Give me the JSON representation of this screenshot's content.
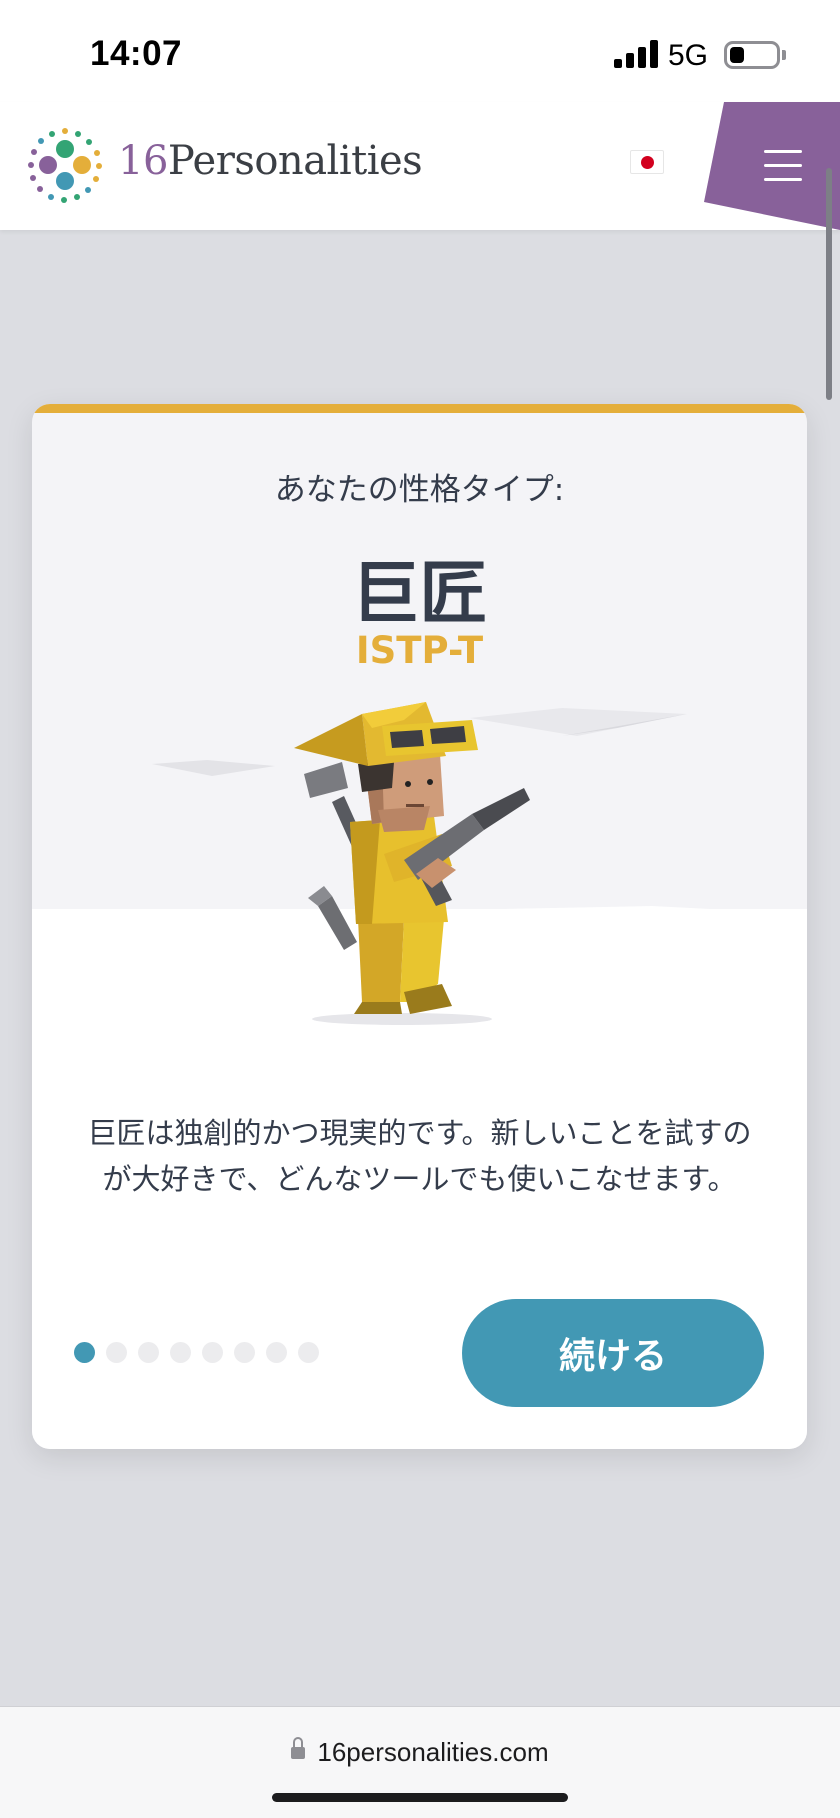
{
  "status_bar": {
    "time": "14:07",
    "network": "5G",
    "icons": [
      "signal-icon",
      "battery-icon"
    ]
  },
  "header": {
    "logo_number": "16",
    "logo_word": "Personalities",
    "language_flag": "japan-flag-icon",
    "menu_icon": "hamburger-menu-icon",
    "menu_color": "#88619a"
  },
  "card": {
    "kicker": "あなたの性格タイプ:",
    "type_name": "巨匠",
    "type_code": "ISTP-T",
    "description": "巨匠は独創的かつ現実的です。新しいことを試すのが大好きで、どんなツールでも使いこなせます。",
    "illustration": "virtuoso-character-illustration",
    "accent_color": "#e4ae3a",
    "pagination": {
      "total": 8,
      "current": 1
    },
    "continue_label": "続ける",
    "button_color": "#4298b4"
  },
  "browser": {
    "url": "16personalities.com",
    "lock_icon": "lock-icon"
  }
}
